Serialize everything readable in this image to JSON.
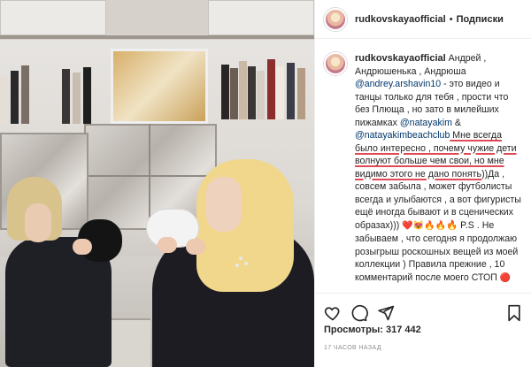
{
  "header": {
    "username": "rudkovskayaofficial",
    "separator": "•",
    "follow_label": "Подписки"
  },
  "caption": {
    "username": "rudkovskayaofficial",
    "part1": "Андрей , Андрюшенька , Андрюша ",
    "mention1": "@andrey.arshavin10",
    "part2": " - это видео и танцы только для тебя , прости что без Плюща , но зато в милейших пижамках ",
    "mention2": "@natayakim",
    "part3": " & ",
    "mention3": "@natayakimbeachclub",
    "underlined": " Мне всегда было интересно , почему чужие дети волнуют больше чем свои, но мне видимо этого не дано понять",
    "part4": "))Да , совсем забыла , может футболисты всегда и улыбаются , а вот фигуристы ещё иногда бывают и в сценических образах))) ",
    "emojis1": "❤️😻🔥🔥",
    "part5": "🔥 P.S . Не забываем , что сегодня я продолжаю розыгрыш роскошных вещей из моей коллекции ) Правила прежние , 10 комментарий после моего СТОП ",
    "emojis2": "🔴"
  },
  "stats": {
    "views": "Просмотры: 317 442",
    "timestamp": "17 ЧАСОВ НАЗАД"
  },
  "icons": [
    "heart-icon",
    "comment-icon",
    "share-icon",
    "bookmark-icon"
  ]
}
